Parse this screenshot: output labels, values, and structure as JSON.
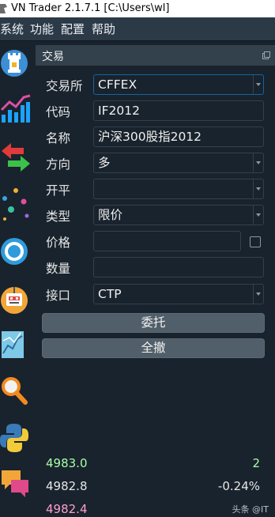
{
  "window": {
    "title": "VN Trader 2.1.7.1 [C:\\Users\\wl]"
  },
  "menu": {
    "items": [
      "系统",
      "功能",
      "配置",
      "帮助"
    ]
  },
  "sidebar": {
    "tools": [
      "rook-icon",
      "bar-chart-icon",
      "exchange-arrows-icon",
      "network-icon",
      "ring-icon",
      "robot-icon",
      "chart-map-icon",
      "magnifier-icon",
      "python-icon",
      "chat-icon"
    ]
  },
  "panel": {
    "title": "交易"
  },
  "form": {
    "exchange_label": "交易所",
    "exchange_value": "CFFEX",
    "code_label": "代码",
    "code_value": "IF2012",
    "name_label": "名称",
    "name_value": "沪深300股指2012",
    "direction_label": "方向",
    "direction_value": "多",
    "offset_label": "开平",
    "offset_value": "",
    "type_label": "类型",
    "type_value": "限价",
    "price_label": "价格",
    "price_value": "",
    "volume_label": "数量",
    "volume_value": "",
    "gateway_label": "接口",
    "gateway_value": "CTP"
  },
  "buttons": {
    "send_label": "委托",
    "cancel_all_label": "全撤"
  },
  "quotes": {
    "bid_price_1": "4983.0",
    "bid_volume_1": "2",
    "last_price": "4982.8",
    "change_pct": "-0.24%",
    "ask_price_1": "4982.4"
  },
  "watermark": "头条 @IT",
  "colors": {
    "bid": "#a8ffa8",
    "ask": "#ff9ecf",
    "neutral": "#e6e6e6",
    "accent": "#1464a0"
  }
}
